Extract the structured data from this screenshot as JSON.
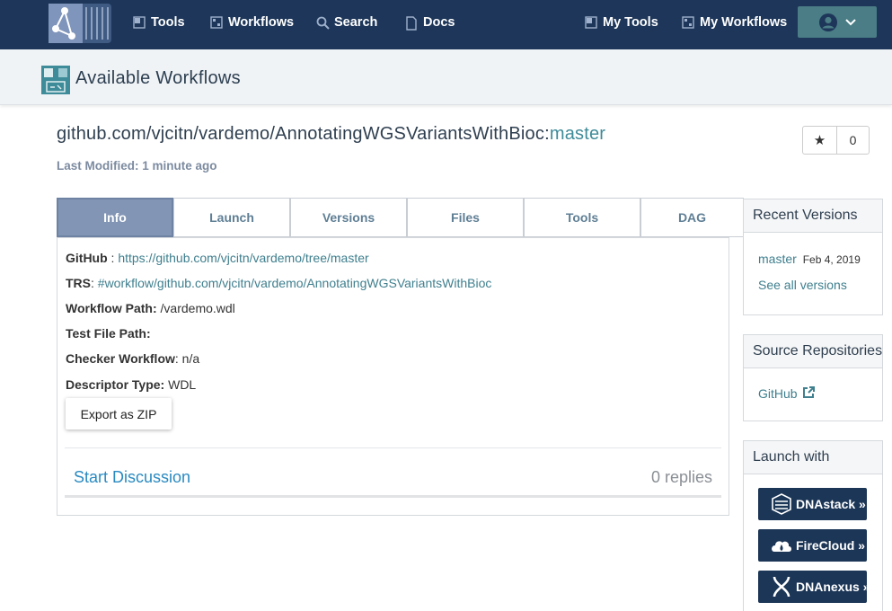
{
  "navbar": {
    "items": [
      {
        "label": "Tools",
        "icon": "tools-icon"
      },
      {
        "label": "Workflows",
        "icon": "workflows-icon"
      },
      {
        "label": "Search",
        "icon": "search-icon"
      },
      {
        "label": "Docs",
        "icon": "docs-icon"
      },
      {
        "label": "My Tools",
        "icon": "my-tools-icon"
      },
      {
        "label": "My Workflows",
        "icon": "my-workflows-icon"
      }
    ]
  },
  "subheader": {
    "title": "Available Workflows"
  },
  "workflow": {
    "path": "github.com/vjcitn/vardemo/AnnotatingWGSVariantsWithBioc:",
    "branch": "master",
    "last_modified": "Last Modified: 1 minute ago",
    "star_count": "0"
  },
  "tabs": [
    "Info",
    "Launch",
    "Versions",
    "Files",
    "Tools",
    "DAG"
  ],
  "info": {
    "github_label": "GitHub",
    "github_sep": " : ",
    "github_url": "https://github.com/vjcitn/vardemo/tree/master",
    "trs_label": "TRS",
    "trs_sep": ": ",
    "trs_value": "#workflow/github.com/vjcitn/vardemo/AnnotatingWGSVariantsWithBioc",
    "workflow_path_label": "Workflow Path:",
    "workflow_path_value": " /vardemo.wdl",
    "test_file_label": "Test File Path:",
    "checker_label": "Checker Workflow",
    "checker_value": ": n/a",
    "descriptor_label": "Descriptor Type:",
    "descriptor_value": " WDL",
    "export_label": "Export as ZIP",
    "discussion_label": "Start Discussion",
    "replies_label": "0 replies"
  },
  "recent_versions": {
    "title": "Recent Versions",
    "version": "master",
    "date": "Feb 4, 2019",
    "see_all": "See all versions"
  },
  "source_repos": {
    "title": "Source Repositories",
    "link": "GitHub"
  },
  "launch_with": {
    "title": "Launch with",
    "buttons": [
      "DNAstack »",
      "FireCloud »",
      "DNAnexus »"
    ]
  },
  "colors": {
    "navbar": "#1d3659",
    "accent": "#3f7f8e",
    "active_tab": "#8295b4"
  }
}
